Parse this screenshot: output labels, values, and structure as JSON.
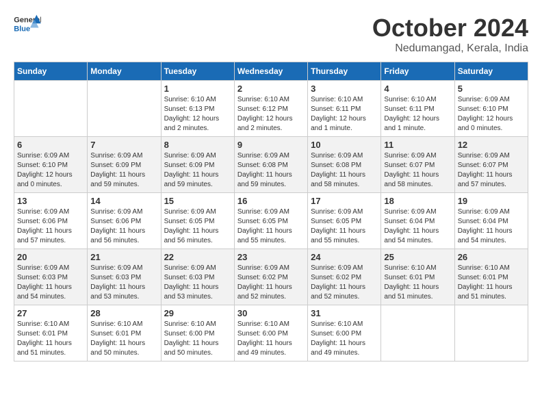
{
  "header": {
    "logo_general": "General",
    "logo_blue": "Blue",
    "month": "October 2024",
    "location": "Nedumangad, Kerala, India"
  },
  "weekdays": [
    "Sunday",
    "Monday",
    "Tuesday",
    "Wednesday",
    "Thursday",
    "Friday",
    "Saturday"
  ],
  "weeks": [
    [
      {
        "day": "",
        "info": ""
      },
      {
        "day": "",
        "info": ""
      },
      {
        "day": "1",
        "info": "Sunrise: 6:10 AM\nSunset: 6:13 PM\nDaylight: 12 hours and 2 minutes."
      },
      {
        "day": "2",
        "info": "Sunrise: 6:10 AM\nSunset: 6:12 PM\nDaylight: 12 hours and 2 minutes."
      },
      {
        "day": "3",
        "info": "Sunrise: 6:10 AM\nSunset: 6:11 PM\nDaylight: 12 hours and 1 minute."
      },
      {
        "day": "4",
        "info": "Sunrise: 6:10 AM\nSunset: 6:11 PM\nDaylight: 12 hours and 1 minute."
      },
      {
        "day": "5",
        "info": "Sunrise: 6:09 AM\nSunset: 6:10 PM\nDaylight: 12 hours and 0 minutes."
      }
    ],
    [
      {
        "day": "6",
        "info": "Sunrise: 6:09 AM\nSunset: 6:10 PM\nDaylight: 12 hours and 0 minutes."
      },
      {
        "day": "7",
        "info": "Sunrise: 6:09 AM\nSunset: 6:09 PM\nDaylight: 11 hours and 59 minutes."
      },
      {
        "day": "8",
        "info": "Sunrise: 6:09 AM\nSunset: 6:09 PM\nDaylight: 11 hours and 59 minutes."
      },
      {
        "day": "9",
        "info": "Sunrise: 6:09 AM\nSunset: 6:08 PM\nDaylight: 11 hours and 59 minutes."
      },
      {
        "day": "10",
        "info": "Sunrise: 6:09 AM\nSunset: 6:08 PM\nDaylight: 11 hours and 58 minutes."
      },
      {
        "day": "11",
        "info": "Sunrise: 6:09 AM\nSunset: 6:07 PM\nDaylight: 11 hours and 58 minutes."
      },
      {
        "day": "12",
        "info": "Sunrise: 6:09 AM\nSunset: 6:07 PM\nDaylight: 11 hours and 57 minutes."
      }
    ],
    [
      {
        "day": "13",
        "info": "Sunrise: 6:09 AM\nSunset: 6:06 PM\nDaylight: 11 hours and 57 minutes."
      },
      {
        "day": "14",
        "info": "Sunrise: 6:09 AM\nSunset: 6:06 PM\nDaylight: 11 hours and 56 minutes."
      },
      {
        "day": "15",
        "info": "Sunrise: 6:09 AM\nSunset: 6:05 PM\nDaylight: 11 hours and 56 minutes."
      },
      {
        "day": "16",
        "info": "Sunrise: 6:09 AM\nSunset: 6:05 PM\nDaylight: 11 hours and 55 minutes."
      },
      {
        "day": "17",
        "info": "Sunrise: 6:09 AM\nSunset: 6:05 PM\nDaylight: 11 hours and 55 minutes."
      },
      {
        "day": "18",
        "info": "Sunrise: 6:09 AM\nSunset: 6:04 PM\nDaylight: 11 hours and 54 minutes."
      },
      {
        "day": "19",
        "info": "Sunrise: 6:09 AM\nSunset: 6:04 PM\nDaylight: 11 hours and 54 minutes."
      }
    ],
    [
      {
        "day": "20",
        "info": "Sunrise: 6:09 AM\nSunset: 6:03 PM\nDaylight: 11 hours and 54 minutes."
      },
      {
        "day": "21",
        "info": "Sunrise: 6:09 AM\nSunset: 6:03 PM\nDaylight: 11 hours and 53 minutes."
      },
      {
        "day": "22",
        "info": "Sunrise: 6:09 AM\nSunset: 6:03 PM\nDaylight: 11 hours and 53 minutes."
      },
      {
        "day": "23",
        "info": "Sunrise: 6:09 AM\nSunset: 6:02 PM\nDaylight: 11 hours and 52 minutes."
      },
      {
        "day": "24",
        "info": "Sunrise: 6:09 AM\nSunset: 6:02 PM\nDaylight: 11 hours and 52 minutes."
      },
      {
        "day": "25",
        "info": "Sunrise: 6:10 AM\nSunset: 6:01 PM\nDaylight: 11 hours and 51 minutes."
      },
      {
        "day": "26",
        "info": "Sunrise: 6:10 AM\nSunset: 6:01 PM\nDaylight: 11 hours and 51 minutes."
      }
    ],
    [
      {
        "day": "27",
        "info": "Sunrise: 6:10 AM\nSunset: 6:01 PM\nDaylight: 11 hours and 51 minutes."
      },
      {
        "day": "28",
        "info": "Sunrise: 6:10 AM\nSunset: 6:01 PM\nDaylight: 11 hours and 50 minutes."
      },
      {
        "day": "29",
        "info": "Sunrise: 6:10 AM\nSunset: 6:00 PM\nDaylight: 11 hours and 50 minutes."
      },
      {
        "day": "30",
        "info": "Sunrise: 6:10 AM\nSunset: 6:00 PM\nDaylight: 11 hours and 49 minutes."
      },
      {
        "day": "31",
        "info": "Sunrise: 6:10 AM\nSunset: 6:00 PM\nDaylight: 11 hours and 49 minutes."
      },
      {
        "day": "",
        "info": ""
      },
      {
        "day": "",
        "info": ""
      }
    ]
  ]
}
